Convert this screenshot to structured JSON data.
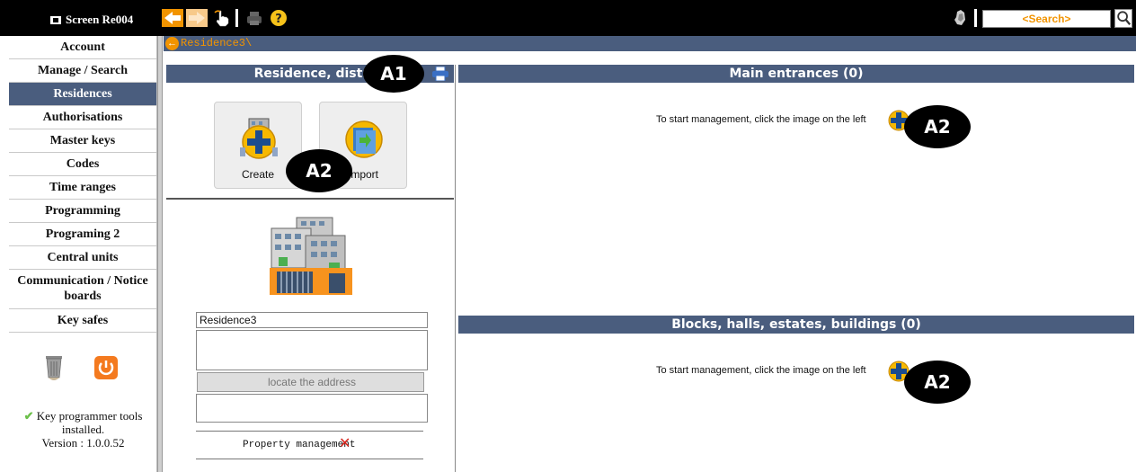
{
  "topbar": {
    "screen_label": "Screen Re004",
    "search_placeholder": "<Search>"
  },
  "sidebar": {
    "items": [
      {
        "label": "Account"
      },
      {
        "label": "Manage / Search"
      },
      {
        "label": "Residences",
        "active": true
      },
      {
        "label": "Authorisations"
      },
      {
        "label": "Master keys"
      },
      {
        "label": "Codes"
      },
      {
        "label": "Time ranges"
      },
      {
        "label": "Programming"
      },
      {
        "label": "Programing 2"
      },
      {
        "label": "Central units"
      },
      {
        "label": "Communication / Notice boards"
      },
      {
        "label": "Key safes"
      }
    ],
    "status_line1": "Key programmer tools installed.",
    "status_line2": "Version : 1.0.0.52"
  },
  "breadcrumb": {
    "path": "Residence3\\"
  },
  "left_panel": {
    "header": "Residence, district",
    "create_label": "Create",
    "import_label": "Import",
    "name_value": "Residence3",
    "locate_button": "locate the address",
    "property_management": "Property management"
  },
  "right_panel": {
    "main_entrances_header": "Main entrances (0)",
    "blocks_header": "Blocks, halls, estates, buildings (0)",
    "hint_text": "To start management, click the image on the left"
  },
  "callouts": {
    "a1": "A1",
    "a2": "A2"
  },
  "colors": {
    "header_bg": "#4a5d7e",
    "accent_orange": "#f29400",
    "topbar_bg": "#000000"
  }
}
